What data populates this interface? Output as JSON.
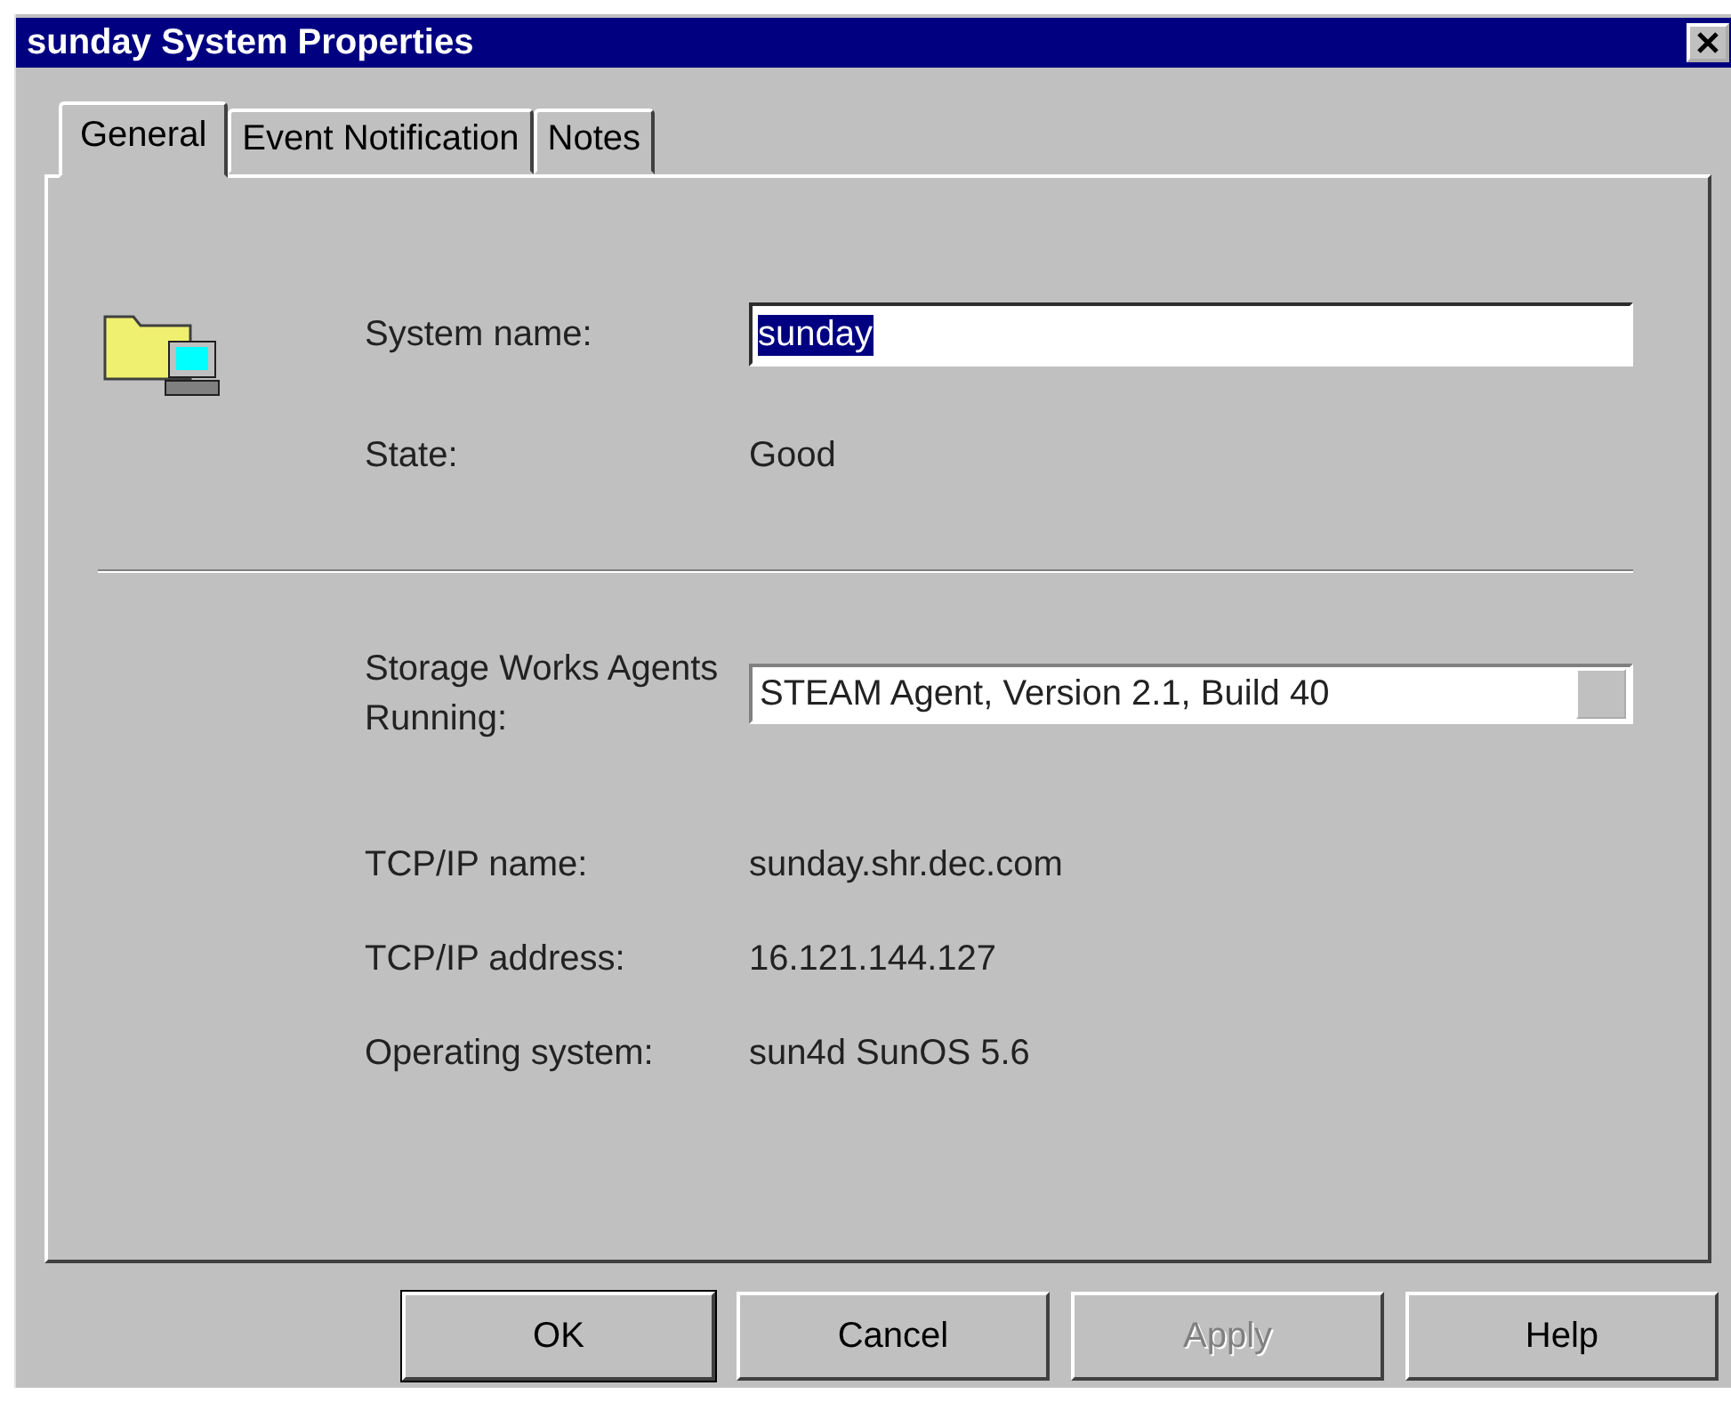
{
  "window": {
    "title": "sunday System Properties"
  },
  "tabs": [
    {
      "label": "General",
      "selected": true
    },
    {
      "label": "Event Notification",
      "selected": false
    },
    {
      "label": "Notes",
      "selected": false
    }
  ],
  "system_name": {
    "label": "System name:",
    "value": "sunday",
    "text_selected": true
  },
  "state": {
    "label": "State:",
    "value": "Good"
  },
  "agents": {
    "label": "Storage Works Agents Running:",
    "value": "STEAM Agent, Version 2.1, Build 40"
  },
  "info": [
    {
      "label": "TCP/IP name:",
      "value": "sunday.shr.dec.com"
    },
    {
      "label": "TCP/IP address:",
      "value": "16.121.144.127"
    },
    {
      "label": "Operating system:",
      "value": "sun4d SunOS 5.6"
    }
  ],
  "buttons": [
    {
      "label": "OK",
      "default": true,
      "disabled": false
    },
    {
      "label": "Cancel",
      "default": false,
      "disabled": false
    },
    {
      "label": "Apply",
      "default": false,
      "disabled": true
    },
    {
      "label": "Help",
      "default": false,
      "disabled": false
    }
  ]
}
